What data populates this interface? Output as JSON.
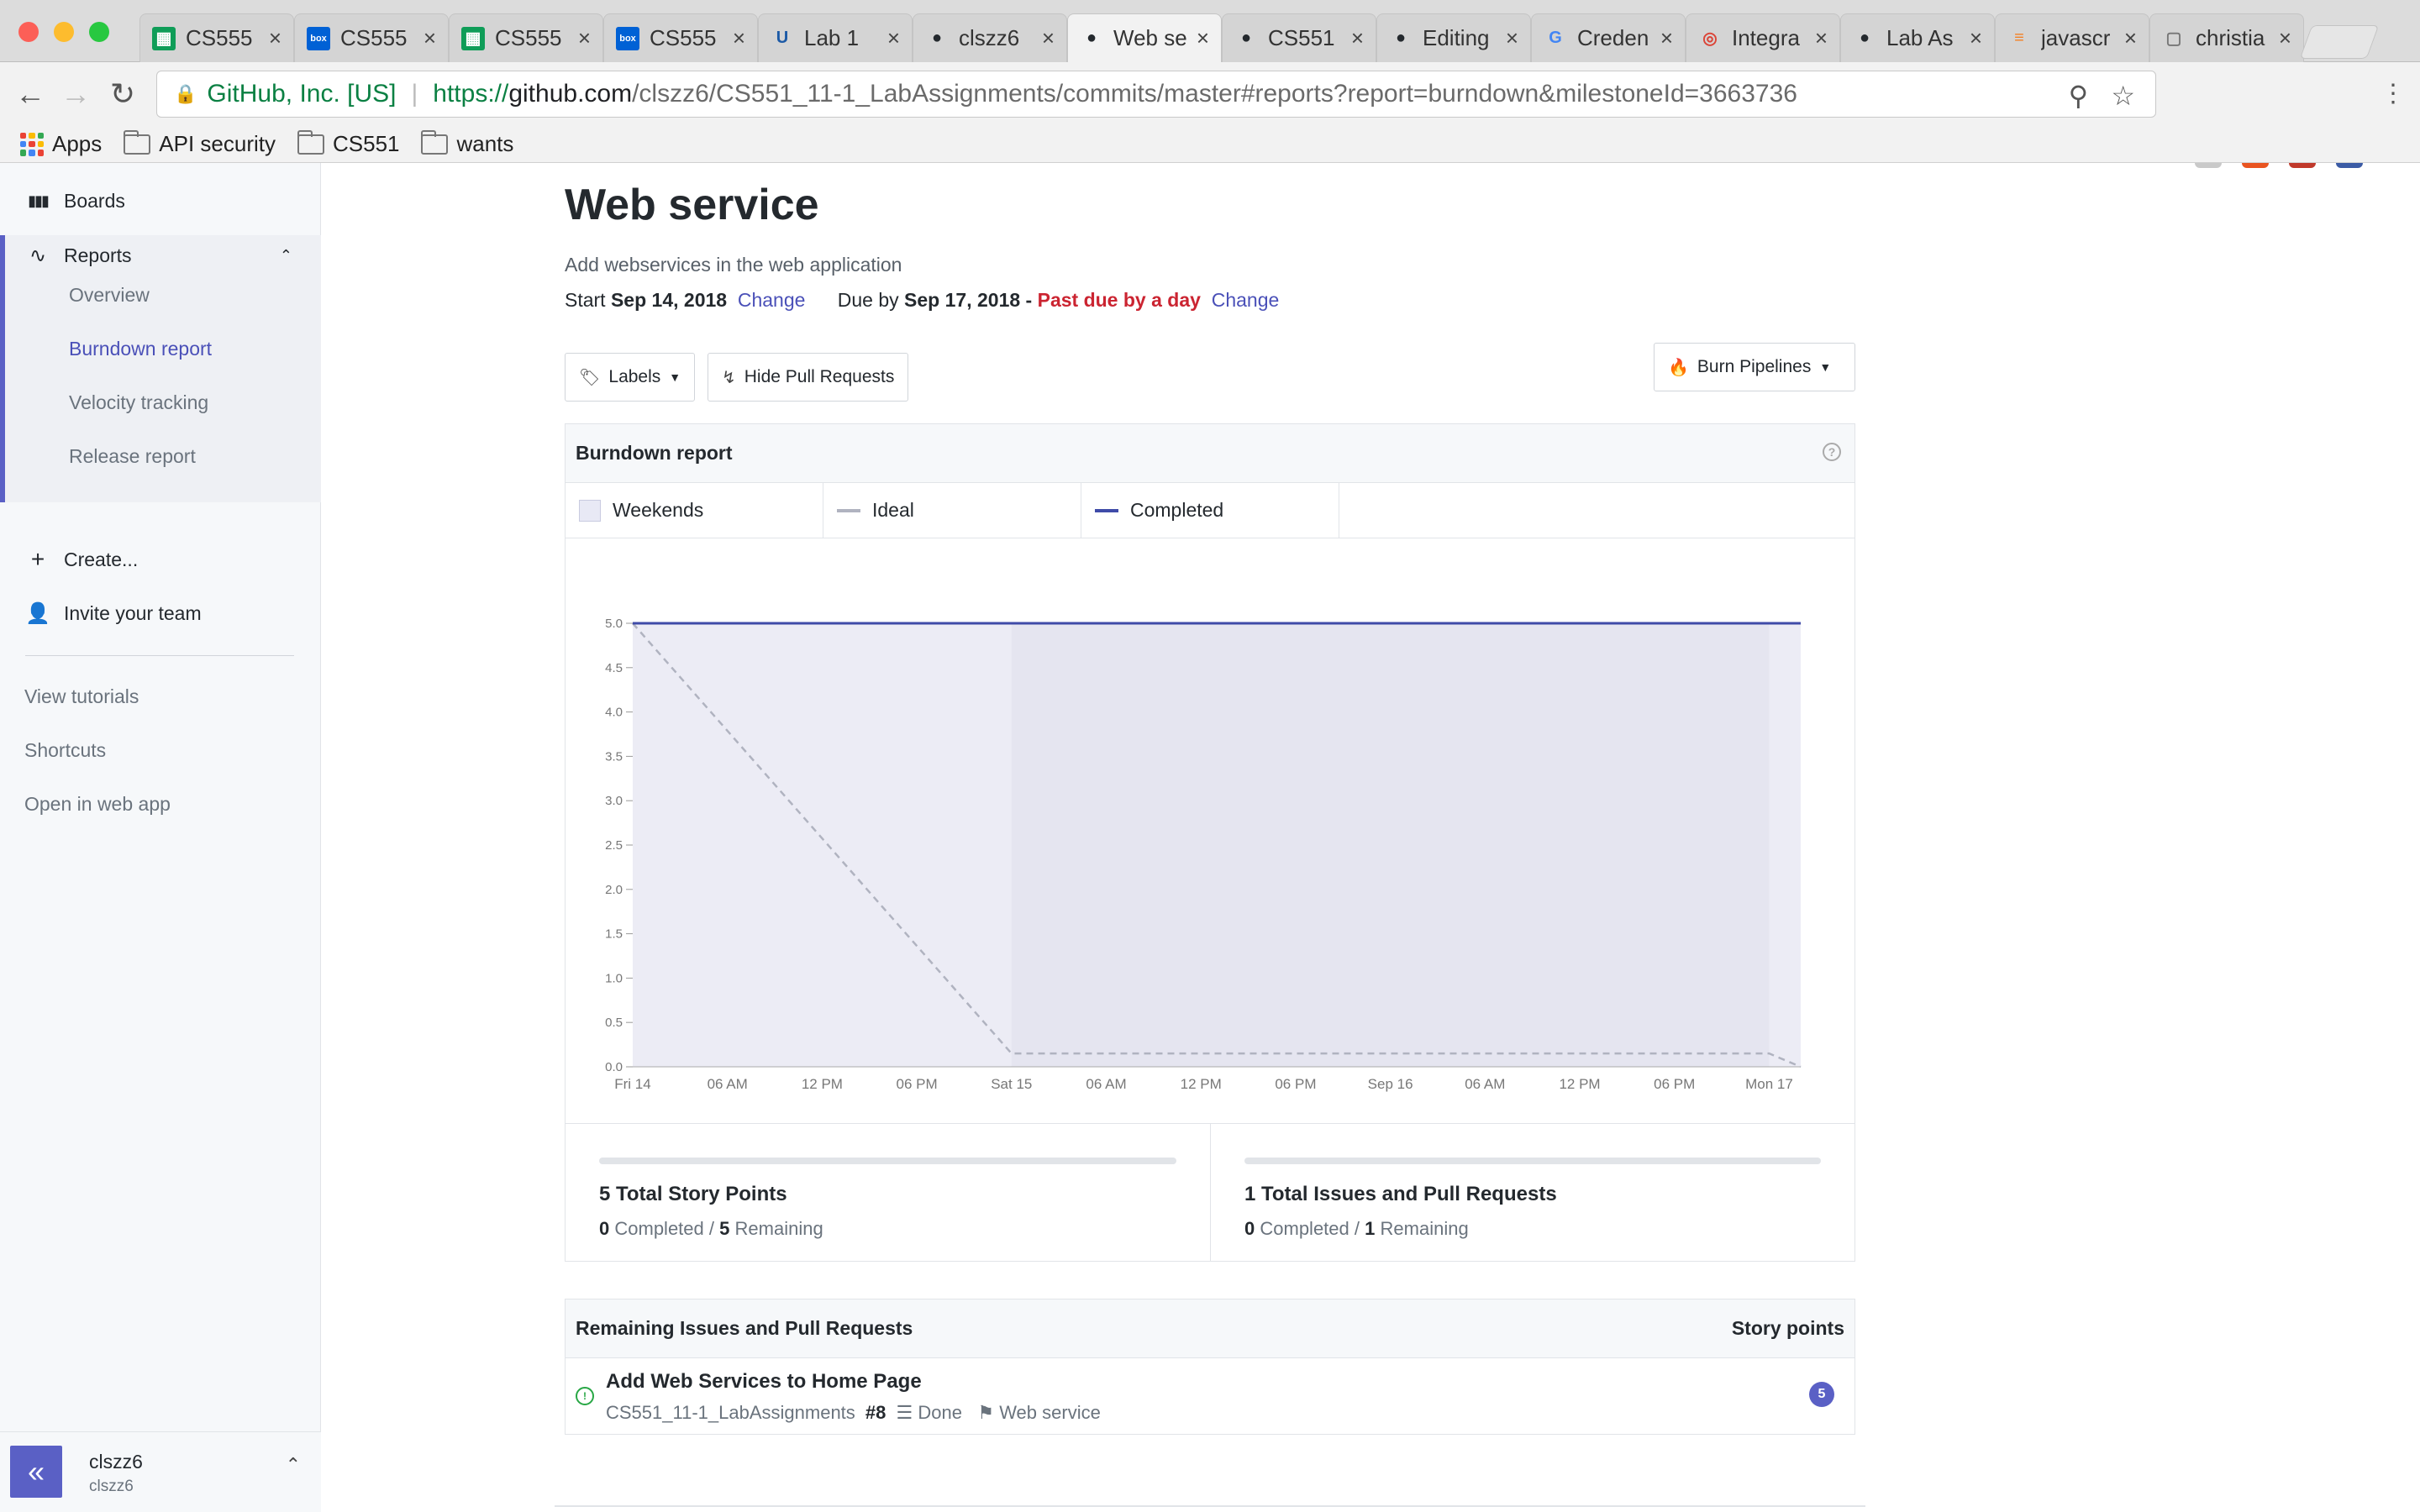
{
  "browser": {
    "tabs": [
      {
        "label": "CS555",
        "icon": "sheets-icon",
        "color": "#0f9d58"
      },
      {
        "label": "CS555",
        "icon": "box-icon",
        "color": "#0061d5"
      },
      {
        "label": "CS555",
        "icon": "sheets-icon",
        "color": "#0f9d58"
      },
      {
        "label": "CS555",
        "icon": "box-icon",
        "color": "#0061d5"
      },
      {
        "label": "Lab 1",
        "icon": "umkc-icon",
        "color": "#1c5aa6"
      },
      {
        "label": "clszz6",
        "icon": "github-icon",
        "color": "#24292e"
      },
      {
        "label": "Web se",
        "icon": "github-icon",
        "color": "#24292e"
      },
      {
        "label": "CS551",
        "icon": "github-icon",
        "color": "#24292e"
      },
      {
        "label": "Editing",
        "icon": "github-icon",
        "color": "#24292e"
      },
      {
        "label": "Creden",
        "icon": "google-icon",
        "color": "#4285f4"
      },
      {
        "label": "Integra",
        "icon": "integration-icon",
        "color": "#db4437"
      },
      {
        "label": "Lab As",
        "icon": "github-icon",
        "color": "#24292e"
      },
      {
        "label": "javascr",
        "icon": "stackoverflow-icon",
        "color": "#f48024"
      },
      {
        "label": "christia",
        "icon": "document-icon",
        "color": "#777777"
      }
    ],
    "active_tab_index": 6,
    "secure_label": "GitHub, Inc. [US]",
    "url_scheme": "https://",
    "url_host": "github.com",
    "url_path": "/clszz6/CS551_11-1_LabAssignments/commits/master#reports?report=burndown&milestoneId=3663736",
    "extensions": [
      {
        "icon": "react-devtools-icon",
        "color": "#c9c9c9",
        "text": "⚛"
      },
      {
        "icon": "ubuntu-icon",
        "color": "#e95420",
        "text": "◉"
      },
      {
        "icon": "cors-icon",
        "color": "#c0392b",
        "text": "CORS"
      },
      {
        "icon": "zotero-icon",
        "color": "#3b5ba5",
        "text": "Z"
      }
    ],
    "bookmarks": {
      "apps": "Apps",
      "folders": [
        "API security",
        "CS551",
        "wants"
      ]
    }
  },
  "sidebar": {
    "boards": "Boards",
    "reports": "Reports",
    "report_items": [
      "Overview",
      "Burndown report",
      "Velocity tracking",
      "Release report"
    ],
    "active_report_index": 1,
    "create": "Create...",
    "invite": "Invite your team",
    "links": [
      "View tutorials",
      "Shortcuts",
      "Open in web app"
    ],
    "user": {
      "name": "clszz6",
      "login": "clszz6"
    },
    "collapse_label": "«"
  },
  "milestone": {
    "title": "Web service",
    "description": "Add webservices in the web application",
    "start_label": "Start",
    "start_date": "Sep 14, 2018",
    "change_label": "Change",
    "due_label": "Due by",
    "due_date": "Sep 17, 2018",
    "dash": "-",
    "past_due": "Past due by a day"
  },
  "toolbar": {
    "labels_button": "Labels",
    "hide_pr_button": "Hide Pull Requests",
    "burn_button": "Burn Pipelines"
  },
  "report": {
    "header": "Burndown report",
    "help": "?",
    "legend": [
      {
        "label": "Weekends",
        "kind": "box",
        "color": "#e8e9f5"
      },
      {
        "label": "Ideal",
        "kind": "line",
        "color": "#b0b3c0"
      },
      {
        "label": "Completed",
        "kind": "line",
        "color": "#3f4ba8"
      }
    ],
    "stats": [
      {
        "title": "5 Total Story Points",
        "completed_value": "0",
        "completed_label": "Completed",
        "sep": "/",
        "remaining_value": "5",
        "remaining_label": "Remaining",
        "progress": 0
      },
      {
        "title": "1 Total Issues and Pull Requests",
        "completed_value": "0",
        "completed_label": "Completed",
        "sep": "/",
        "remaining_value": "1",
        "remaining_label": "Remaining",
        "progress": 0
      }
    ]
  },
  "chart_data": {
    "type": "line",
    "title": "",
    "xlabel": "",
    "ylabel": "",
    "x_ticks": [
      "Fri 14",
      "06 AM",
      "12 PM",
      "06 PM",
      "Sat 15",
      "06 AM",
      "12 PM",
      "06 PM",
      "Sep 16",
      "06 AM",
      "12 PM",
      "06 PM",
      "Mon 17"
    ],
    "x_tick_hours": [
      0,
      6,
      12,
      18,
      24,
      30,
      36,
      42,
      48,
      54,
      60,
      66,
      72
    ],
    "x_range_hours": [
      0,
      74
    ],
    "y_ticks": [
      "0.0",
      "0.5",
      "1.0",
      "1.5",
      "2.0",
      "2.5",
      "3.0",
      "3.5",
      "4.0",
      "4.5",
      "5.0"
    ],
    "ylim": [
      0,
      5
    ],
    "weekend_band_hours": [
      24,
      72
    ],
    "series": [
      {
        "name": "Ideal",
        "points": [
          [
            0,
            5.0
          ],
          [
            24,
            0.15
          ],
          [
            72,
            0.15
          ],
          [
            74,
            0.0
          ]
        ],
        "color": "#b0b3c0",
        "dashed": true
      },
      {
        "name": "Completed",
        "points": [
          [
            0,
            5.0
          ],
          [
            74,
            5.0
          ]
        ],
        "color": "#3f4ba8",
        "dashed": false
      }
    ]
  },
  "remaining": {
    "header": "Remaining Issues and Pull Requests",
    "points_header": "Story points",
    "issues": [
      {
        "title": "Add Web Services to Home Page",
        "repo": "CS551_11-1_LabAssignments",
        "number": "#8",
        "pipeline": "Done",
        "milestone": "Web service",
        "points": "5"
      }
    ]
  }
}
